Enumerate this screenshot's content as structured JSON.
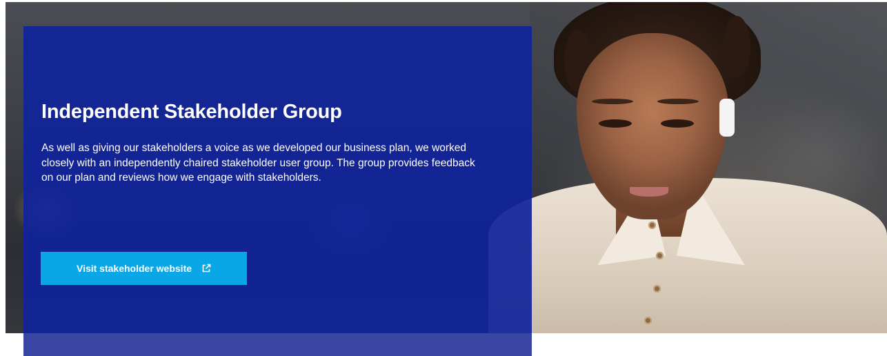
{
  "hero": {
    "title": "Independent Stakeholder Group",
    "body": "As well as giving our stakeholders a voice as we developed our business plan, we worked closely with an independently chaired stakeholder user group. The group provides feedback on our plan and reviews how we engage with stakeholders.",
    "cta_label": "Visit stakeholder website",
    "cta_icon": "external-link-icon"
  },
  "colors": {
    "panel": "#10239b",
    "cta": "#0aa7e8",
    "text": "#ffffff"
  }
}
